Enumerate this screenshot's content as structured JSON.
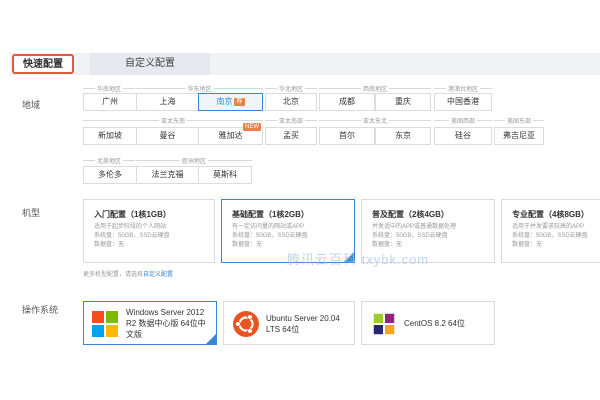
{
  "tabs": {
    "quick": "快速配置",
    "custom": "自定义配置"
  },
  "labels": {
    "region": "地域",
    "model": "机型",
    "os": "操作系统"
  },
  "regions": {
    "south_china": "华南地区",
    "east_china": "华东地区",
    "north_china": "华北地区",
    "southwest": "西南地区",
    "hk_tw": "港澳台地区",
    "se_asia": "亚太东南",
    "south_asia": "亚太南部",
    "ne_asia": "亚太东北",
    "us_west": "美国西部",
    "us_east": "美国东部",
    "north_america": "北美地区",
    "europe": "欧洲地区"
  },
  "cities": {
    "guangzhou": "广州",
    "shanghai": "上海",
    "nanjing": "南京",
    "nanjing_badge": "荐",
    "beijing": "北京",
    "chengdu": "成都",
    "chongqing": "重庆",
    "hongkong": "中国香港",
    "singapore": "新加坡",
    "bangkok": "曼谷",
    "jakarta": "雅加达",
    "jakarta_badge": "NEW",
    "mumbai": "孟买",
    "seoul": "首尔",
    "tokyo": "东京",
    "silicon_valley": "硅谷",
    "virginia": "弗吉尼亚",
    "toronto": "多伦多",
    "frankfurt": "法兰克福",
    "moscow": "莫斯科"
  },
  "configs": [
    {
      "title": "入门配置（1核1GB）",
      "desc": "适用于起步阶段的个人网站",
      "spec": "系统盘：50GB，SSD云硬盘",
      "data": "数据盘：无"
    },
    {
      "title": "基础配置（1核2GB）",
      "desc": "有一定访问量的网站或APP",
      "spec": "系统盘：50GB，SSD云硬盘",
      "data": "数据盘：无"
    },
    {
      "title": "普及配置（2核4GB）",
      "desc": "并发适中的APP或普通数据处理",
      "spec": "系统盘：50GB，SSD云硬盘",
      "data": "数据盘：无"
    },
    {
      "title": "专业配置（4核8GB）",
      "desc": "适用于并发要求较高的APP",
      "spec": "系统盘：50GB，SSD云硬盘",
      "data": "数据盘：无"
    }
  ],
  "more_note": {
    "text": "更多机型配置，请选择",
    "link": "自定义配置"
  },
  "os": {
    "windows": {
      "line1": "Windows Server 2012",
      "line2": "R2 数据中心版 64位中",
      "line3": "文版"
    },
    "ubuntu": {
      "line1": "Ubuntu Server 20.04",
      "line2": "LTS 64位"
    },
    "centos": {
      "line1": "CentOS 8.2 64位"
    }
  },
  "watermark": "腾讯云百科 txybk.com",
  "colors": {
    "accent": "#3a86d4",
    "highlight": "#e15a3d",
    "badge": "#e8824b"
  }
}
